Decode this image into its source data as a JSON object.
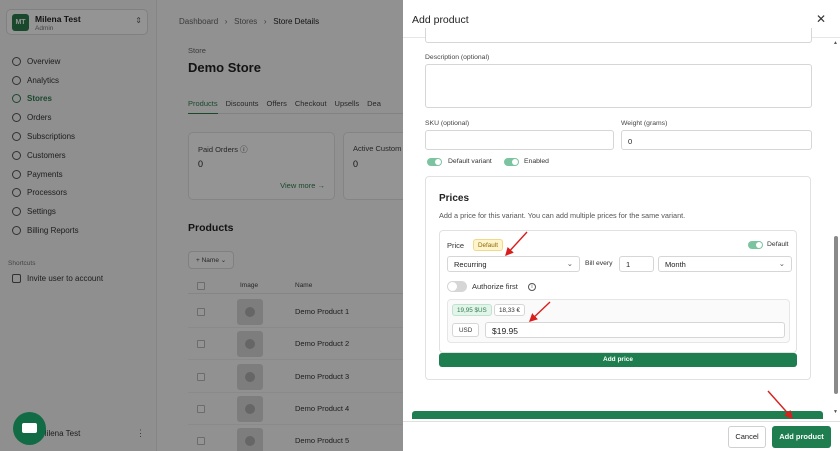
{
  "sidebar": {
    "account": {
      "initials": "MT",
      "name": "Milena Test",
      "role": "Admin"
    },
    "nav": [
      {
        "label": "Overview",
        "icon": "home-icon"
      },
      {
        "label": "Analytics",
        "icon": "chart-icon"
      },
      {
        "label": "Stores",
        "icon": "store-icon",
        "active": true
      },
      {
        "label": "Orders",
        "icon": "orders-icon"
      },
      {
        "label": "Subscriptions",
        "icon": "subscriptions-icon"
      },
      {
        "label": "Customers",
        "icon": "customers-icon"
      },
      {
        "label": "Payments",
        "icon": "payments-icon"
      },
      {
        "label": "Processors",
        "icon": "processors-icon"
      },
      {
        "label": "Settings",
        "icon": "gear-icon"
      },
      {
        "label": "Billing Reports",
        "icon": "reports-icon"
      }
    ],
    "shortcuts_title": "Shortcuts",
    "invite_label": "Invite user to account",
    "bottom_user": "Milena Test"
  },
  "main": {
    "breadcrumb": [
      "Dashboard",
      "Stores",
      "Store Details"
    ],
    "store_label": "Store",
    "store_title": "Demo Store",
    "tabs": [
      "Products",
      "Discounts",
      "Offers",
      "Checkout",
      "Upsells",
      "Dea"
    ],
    "stats": [
      {
        "label": "Paid Orders",
        "value": "0",
        "link": "View more →"
      },
      {
        "label": "Active Custom",
        "value": "0"
      }
    ],
    "products_title": "Products",
    "filter_label": "+ Name ⌄",
    "columns": [
      "Image",
      "Name"
    ],
    "rows": [
      "Demo Product 1",
      "Demo Product 2",
      "Demo Product 3",
      "Demo Product 4",
      "Demo Product 5"
    ]
  },
  "drawer": {
    "title": "Add product",
    "description_label": "Description (optional)",
    "sku_label": "SKU (optional)",
    "weight_label": "Weight (grams)",
    "weight_value": "0",
    "default_variant_label": "Default variant",
    "enabled_label": "Enabled",
    "prices": {
      "title": "Prices",
      "subtitle": "Add a price for this variant. You can add multiple prices for the same variant.",
      "price_label": "Price",
      "default_badge": "Default",
      "default_toggle_label": "Default",
      "type_value": "Recurring",
      "bill_every_label": "Bill every",
      "bill_every_value": "1",
      "interval_value": "Month",
      "authorize_label": "Authorize first",
      "chip_usd": "19,95 $US",
      "chip_eur": "18,33 €",
      "currency": "USD",
      "amount": "$19.95",
      "add_price_label": "Add price"
    },
    "cancel_label": "Cancel",
    "add_product_label": "Add product"
  },
  "colors": {
    "brand": "#1e7e4f",
    "annotation": "#d91e1e"
  }
}
